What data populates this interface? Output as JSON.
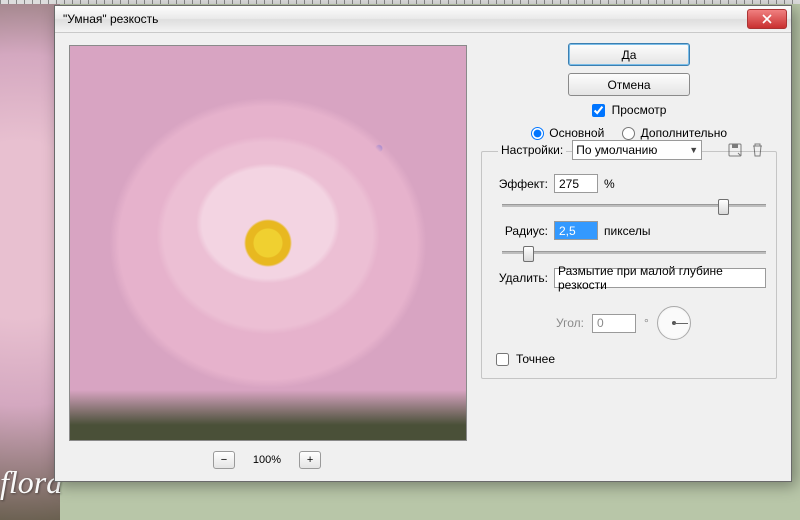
{
  "background": {
    "watermark": "flora"
  },
  "dialog": {
    "title": "\"Умная\" резкость",
    "buttons": {
      "ok": "Да",
      "cancel": "Отмена"
    },
    "preview_checkbox": "Просмотр",
    "preview_checked": true,
    "mode": {
      "basic": "Основной",
      "advanced": "Дополнительно",
      "selected": "basic"
    },
    "settings": {
      "label": "Настройки:",
      "preset": "По умолчанию",
      "save_icon": "save-preset-icon",
      "delete_icon": "delete-preset-icon"
    },
    "params": {
      "amount": {
        "label": "Эффект:",
        "value": "275",
        "unit": "%",
        "thumb_pct": 82
      },
      "radius": {
        "label": "Радиус:",
        "value": "2,5",
        "unit": "пикселы",
        "thumb_pct": 8
      },
      "remove": {
        "label": "Удалить:",
        "value": "Размытие при малой глубине резкости"
      },
      "angle": {
        "label": "Угол:",
        "value": "0",
        "unit": "°"
      },
      "precise": {
        "label": "Точнее",
        "checked": false
      }
    },
    "zoom": {
      "level": "100%",
      "minus": "−",
      "plus": "+"
    }
  }
}
